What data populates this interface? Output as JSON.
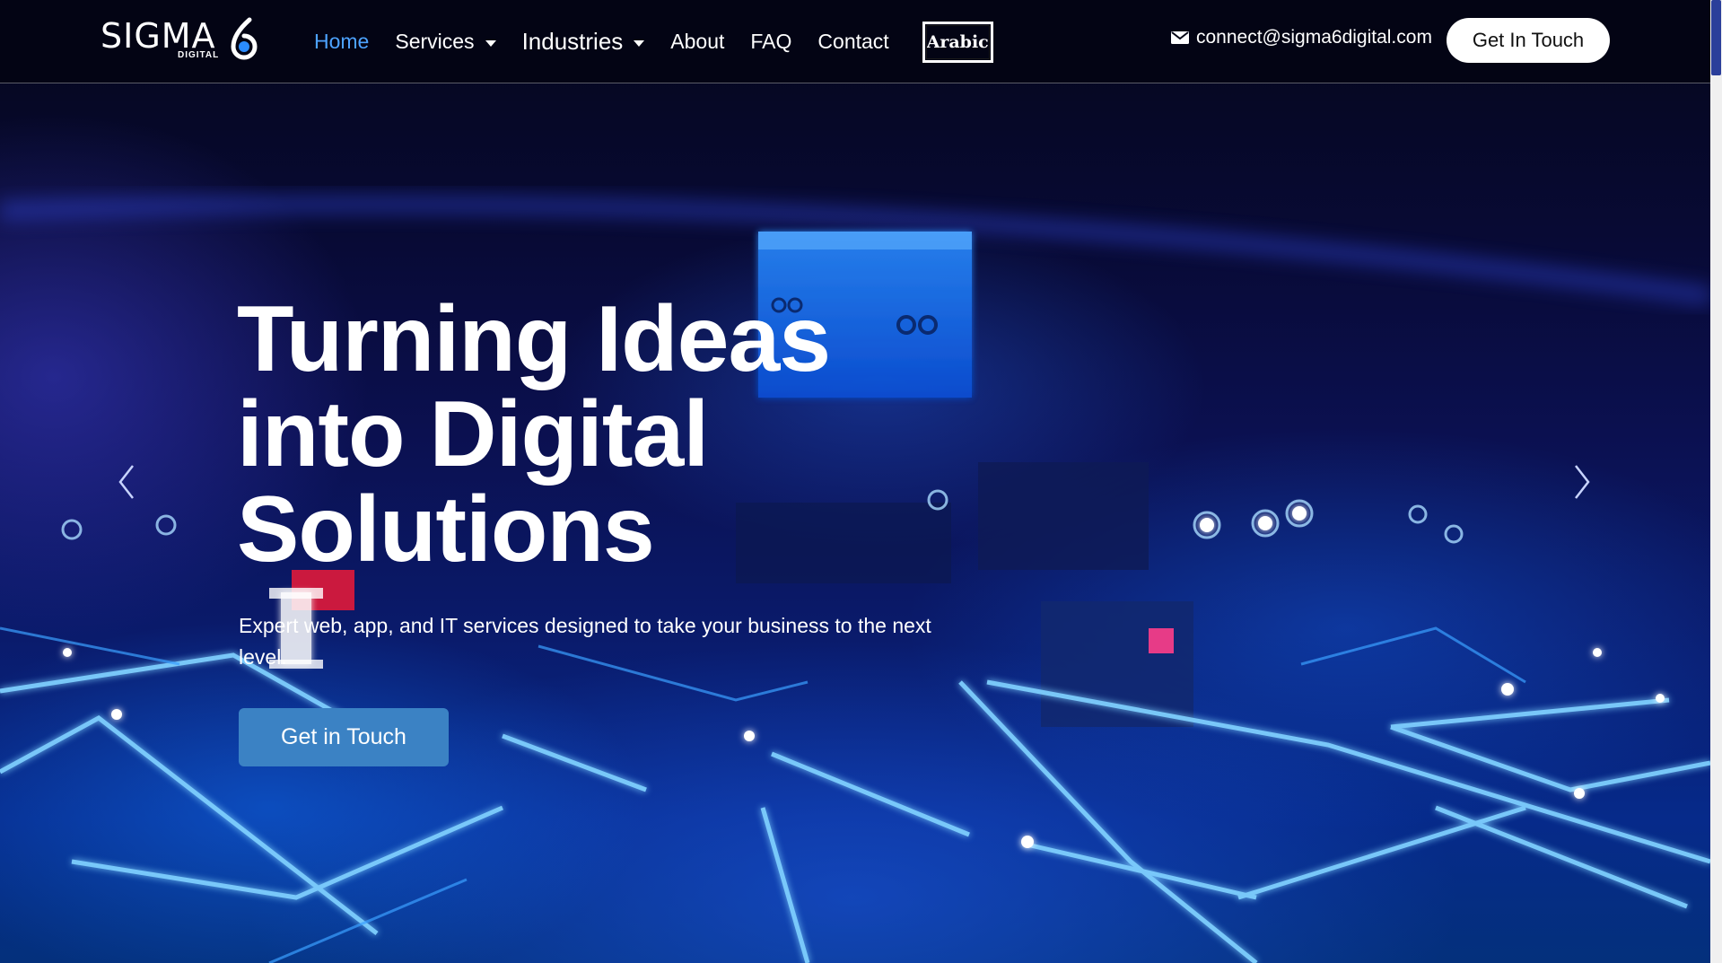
{
  "brand": {
    "logo_text": "SIGMA",
    "logo_sub": "DIGITAL",
    "logo_mark": "6"
  },
  "nav": {
    "items": [
      {
        "label": "Home",
        "active": true
      },
      {
        "label": "Services",
        "dropdown": true
      },
      {
        "label": "Industries",
        "dropdown": true
      },
      {
        "label": "About"
      },
      {
        "label": "FAQ"
      },
      {
        "label": "Contact"
      }
    ],
    "language_button": "Arabic"
  },
  "contact": {
    "email": "connect@sigma6digital.com",
    "email_icon": "mail-icon"
  },
  "header_cta": "Get In Touch",
  "hero": {
    "title": "Turning Ideas into Digital Solutions",
    "subtitle": "Expert web, app, and IT services designed to take your business to the next level.",
    "cta": "Get in Touch",
    "prev_icon": "chevron-left-icon",
    "next_icon": "chevron-right-icon"
  },
  "colors": {
    "accent": "#4da3ff",
    "cta_button": "#3b82c4",
    "header_bg": "#030414"
  }
}
